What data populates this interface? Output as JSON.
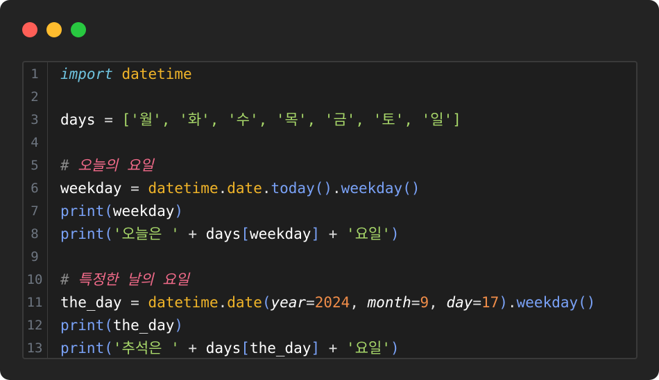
{
  "window": {
    "controls": {
      "close_color": "#ff5f57",
      "minimize_color": "#febc2e",
      "zoom_color": "#28c840"
    }
  },
  "editor": {
    "language": "python",
    "lines": [
      {
        "num": "1",
        "tokens": [
          {
            "t": "import",
            "c": "kw"
          },
          {
            "t": " ",
            "c": "var"
          },
          {
            "t": "datetime",
            "c": "mod"
          }
        ]
      },
      {
        "num": "2",
        "tokens": []
      },
      {
        "num": "3",
        "tokens": [
          {
            "t": "days",
            "c": "var"
          },
          {
            "t": " = ",
            "c": "op"
          },
          {
            "t": "[",
            "c": "str"
          },
          {
            "t": "'월'",
            "c": "str"
          },
          {
            "t": ", ",
            "c": "str"
          },
          {
            "t": "'화'",
            "c": "str"
          },
          {
            "t": ", ",
            "c": "str"
          },
          {
            "t": "'수'",
            "c": "str"
          },
          {
            "t": ", ",
            "c": "str"
          },
          {
            "t": "'목'",
            "c": "str"
          },
          {
            "t": ", ",
            "c": "str"
          },
          {
            "t": "'금'",
            "c": "str"
          },
          {
            "t": ", ",
            "c": "str"
          },
          {
            "t": "'토'",
            "c": "str"
          },
          {
            "t": ", ",
            "c": "str"
          },
          {
            "t": "'일'",
            "c": "str"
          },
          {
            "t": "]",
            "c": "str"
          }
        ]
      },
      {
        "num": "4",
        "tokens": []
      },
      {
        "num": "5",
        "tokens": [
          {
            "t": "# ",
            "c": "cmh"
          },
          {
            "t": "오늘의 요일",
            "c": "cm"
          }
        ]
      },
      {
        "num": "6",
        "tokens": [
          {
            "t": "weekday",
            "c": "var"
          },
          {
            "t": " = ",
            "c": "op"
          },
          {
            "t": "datetime",
            "c": "mod"
          },
          {
            "t": ".",
            "c": "op"
          },
          {
            "t": "date",
            "c": "mod"
          },
          {
            "t": ".",
            "c": "op"
          },
          {
            "t": "today",
            "c": "fn"
          },
          {
            "t": "()",
            "c": "fn"
          },
          {
            "t": ".",
            "c": "op"
          },
          {
            "t": "weekday",
            "c": "fn"
          },
          {
            "t": "()",
            "c": "fn"
          }
        ]
      },
      {
        "num": "7",
        "tokens": [
          {
            "t": "print",
            "c": "fn"
          },
          {
            "t": "(",
            "c": "fn"
          },
          {
            "t": "weekday",
            "c": "var"
          },
          {
            "t": ")",
            "c": "fn"
          }
        ]
      },
      {
        "num": "8",
        "tokens": [
          {
            "t": "print",
            "c": "fn"
          },
          {
            "t": "(",
            "c": "fn"
          },
          {
            "t": "'오늘은 '",
            "c": "str"
          },
          {
            "t": " + ",
            "c": "op"
          },
          {
            "t": "days",
            "c": "var"
          },
          {
            "t": "[",
            "c": "fn"
          },
          {
            "t": "weekday",
            "c": "var"
          },
          {
            "t": "]",
            "c": "fn"
          },
          {
            "t": " + ",
            "c": "op"
          },
          {
            "t": "'요일'",
            "c": "str"
          },
          {
            "t": ")",
            "c": "fn"
          }
        ]
      },
      {
        "num": "9",
        "tokens": []
      },
      {
        "num": "10",
        "tokens": [
          {
            "t": "# ",
            "c": "cmh"
          },
          {
            "t": "특정한 날의 요일",
            "c": "cm"
          }
        ]
      },
      {
        "num": "11",
        "tokens": [
          {
            "t": "the_day",
            "c": "var"
          },
          {
            "t": " = ",
            "c": "op"
          },
          {
            "t": "datetime",
            "c": "mod"
          },
          {
            "t": ".",
            "c": "op"
          },
          {
            "t": "date",
            "c": "mod"
          },
          {
            "t": "(",
            "c": "fn"
          },
          {
            "t": "year",
            "c": "arg"
          },
          {
            "t": "=",
            "c": "op"
          },
          {
            "t": "2024",
            "c": "num"
          },
          {
            "t": ", ",
            "c": "op"
          },
          {
            "t": "month",
            "c": "arg"
          },
          {
            "t": "=",
            "c": "op"
          },
          {
            "t": "9",
            "c": "num"
          },
          {
            "t": ", ",
            "c": "op"
          },
          {
            "t": "day",
            "c": "arg"
          },
          {
            "t": "=",
            "c": "op"
          },
          {
            "t": "17",
            "c": "num"
          },
          {
            "t": ")",
            "c": "fn"
          },
          {
            "t": ".",
            "c": "op"
          },
          {
            "t": "weekday",
            "c": "fn"
          },
          {
            "t": "()",
            "c": "fn"
          }
        ]
      },
      {
        "num": "12",
        "tokens": [
          {
            "t": "print",
            "c": "fn"
          },
          {
            "t": "(",
            "c": "fn"
          },
          {
            "t": "the_day",
            "c": "var"
          },
          {
            "t": ")",
            "c": "fn"
          }
        ]
      },
      {
        "num": "13",
        "tokens": [
          {
            "t": "print",
            "c": "fn"
          },
          {
            "t": "(",
            "c": "fn"
          },
          {
            "t": "'추석은 '",
            "c": "str"
          },
          {
            "t": " + ",
            "c": "op"
          },
          {
            "t": "days",
            "c": "var"
          },
          {
            "t": "[",
            "c": "fn"
          },
          {
            "t": "the_day",
            "c": "var"
          },
          {
            "t": "]",
            "c": "fn"
          },
          {
            "t": " + ",
            "c": "op"
          },
          {
            "t": "'요일'",
            "c": "str"
          },
          {
            "t": ")",
            "c": "fn"
          }
        ]
      }
    ]
  }
}
